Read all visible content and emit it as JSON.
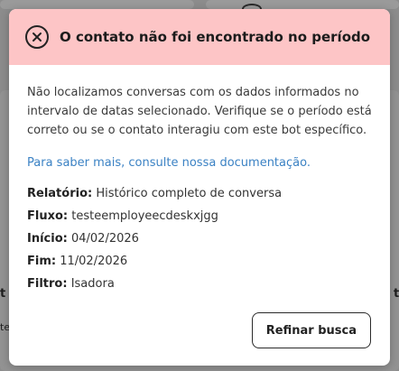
{
  "background": {
    "fragments": [
      "t",
      "te",
      "t"
    ]
  },
  "modal": {
    "header": {
      "title": "O contato não foi encontrado no período",
      "close_icon": "close-circle-icon",
      "bg_color": "#fdc5c6"
    },
    "message": "Não localizamos conversas com os dados informados no intervalo de datas selecionado. Verifique se o período está correto ou se o contato interagiu com este bot específico.",
    "doc_link": "Para saber mais, consulte nossa documentação.",
    "details": [
      {
        "label": "Relatório:",
        "value": "Histórico completo de conversa"
      },
      {
        "label": "Fluxo:",
        "value": "testeemployeecdeskxjgg"
      },
      {
        "label": "Início:",
        "value": "04/02/2026"
      },
      {
        "label": "Fim:",
        "value": "11/02/2026"
      },
      {
        "label": "Filtro:",
        "value": "Isadora"
      }
    ],
    "refine_button": "Refinar busca"
  },
  "colors": {
    "link": "#3b82c4",
    "header": "#fdc5c6"
  }
}
